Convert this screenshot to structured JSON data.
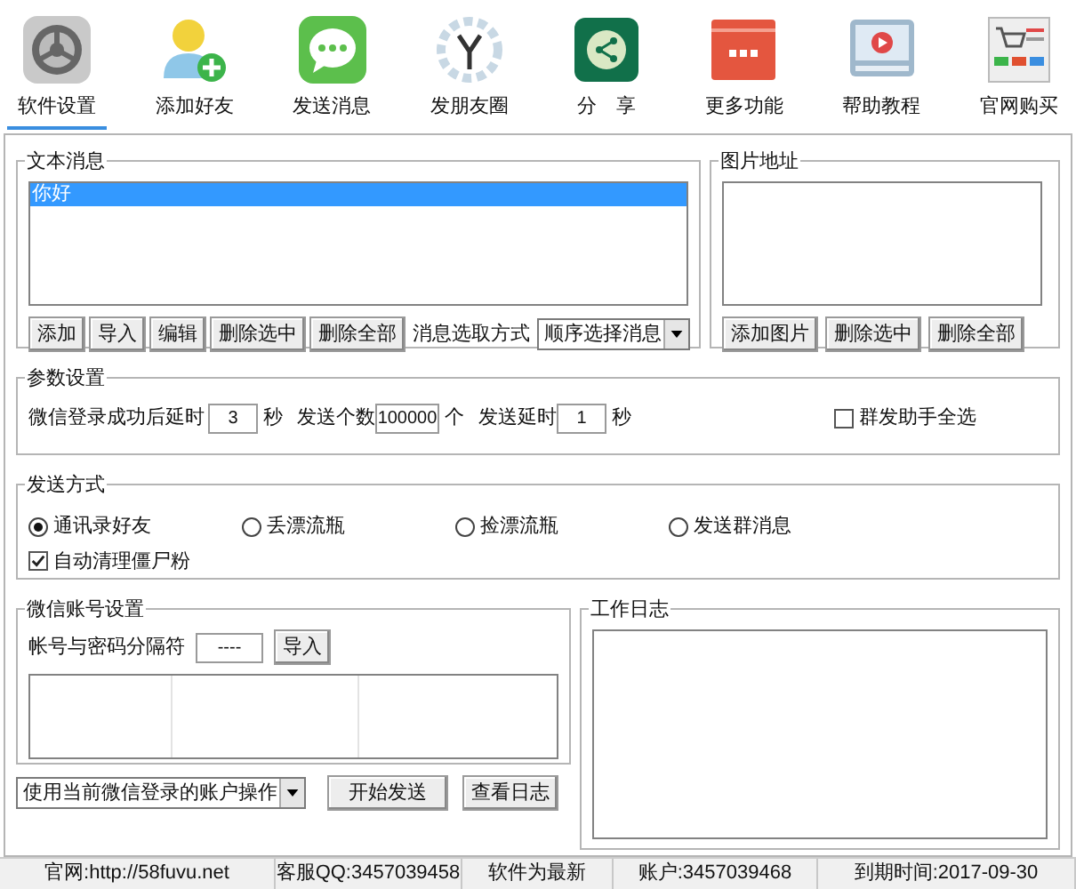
{
  "toolbar": [
    {
      "label": "软件设置",
      "selected": true
    },
    {
      "label": "添加好友",
      "selected": false
    },
    {
      "label": "发送消息",
      "selected": false
    },
    {
      "label": "发朋友圈",
      "selected": false
    },
    {
      "label": "分　享",
      "selected": false
    },
    {
      "label": "更多功能",
      "selected": false
    },
    {
      "label": "帮助教程",
      "selected": false
    },
    {
      "label": "官网购买",
      "selected": false
    }
  ],
  "text_messages": {
    "title": "文本消息",
    "items": [
      {
        "text": "你好",
        "selected": true
      }
    ],
    "buttons": [
      "添加",
      "导入",
      "编辑",
      "删除选中",
      "删除全部"
    ],
    "mode_label": "消息选取方式",
    "mode_value": "顺序选择消息"
  },
  "image_paths": {
    "title": "图片地址",
    "buttons": [
      "添加图片",
      "删除选中",
      "删除全部"
    ]
  },
  "params": {
    "title": "参数设置",
    "login_delay_label": "微信登录成功后延时",
    "login_delay": "3",
    "unit_seconds_1": "秒",
    "send_count_label": "发送个数",
    "send_count": "100000",
    "unit_count": "个",
    "send_delay_label": "发送延时",
    "send_delay": "1",
    "unit_seconds_2": "秒",
    "select_all": {
      "label": "群发助手全选",
      "checked": false
    }
  },
  "send_mode": {
    "title": "发送方式",
    "options": [
      {
        "label": "通讯录好友",
        "selected": true
      },
      {
        "label": "丢漂流瓶",
        "selected": false
      },
      {
        "label": "捡漂流瓶",
        "selected": false
      },
      {
        "label": "发送群消息",
        "selected": false
      }
    ],
    "auto_clean": {
      "label": "自动清理僵尸粉",
      "checked": true
    }
  },
  "account": {
    "title": "微信账号设置",
    "separator_label": "帐号与密码分隔符",
    "separator": "----",
    "import_button": "导入"
  },
  "log": {
    "title": "工作日志"
  },
  "bottom": {
    "account_mode": "使用当前微信登录的账户操作",
    "start_button": "开始发送",
    "view_log_button": "查看日志"
  },
  "status_bar": [
    "官网:http://58fuvu.net",
    "客服QQ:3457039458",
    "软件为最新",
    "账户:3457039468",
    "到期时间:2017-09-30"
  ]
}
